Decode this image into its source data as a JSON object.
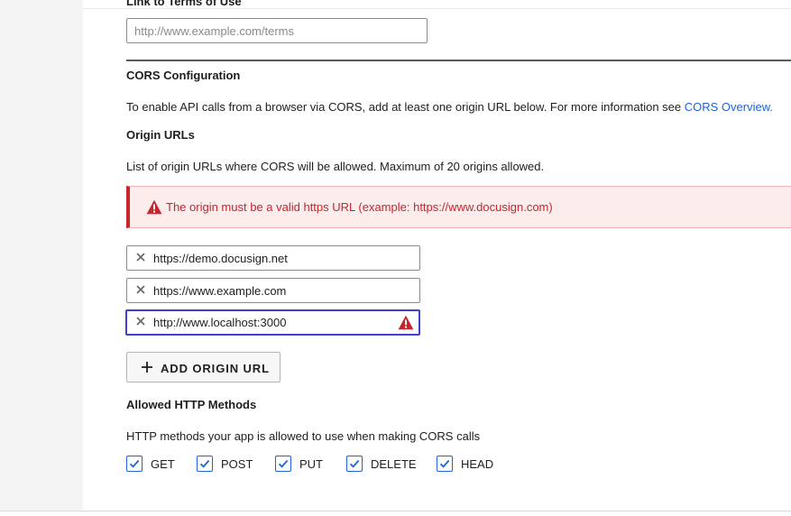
{
  "terms": {
    "label": "Link to Terms of Use",
    "placeholder": "http://www.example.com/terms"
  },
  "cors": {
    "heading": "CORS Configuration",
    "description": "To enable API calls from a browser via CORS, add at least one origin URL below. For more information see ",
    "link": "CORS Overview."
  },
  "origins": {
    "heading": "Origin URLs",
    "description": "List of origin URLs where CORS will be allowed. Maximum of 20 origins allowed.",
    "error_message": "The origin must be a valid https URL (example: https://www.docusign.com)",
    "items": [
      {
        "value": "https://demo.docusign.net"
      },
      {
        "value": "https://www.example.com"
      },
      {
        "value": "http://www.localhost:3000",
        "invalid": true
      }
    ],
    "add_button": "ADD ORIGIN URL"
  },
  "methods": {
    "heading": "Allowed HTTP Methods",
    "description": "HTTP methods your app is allowed to use when making CORS calls",
    "items": [
      {
        "label": "GET",
        "checked": true
      },
      {
        "label": "POST",
        "checked": true
      },
      {
        "label": "PUT",
        "checked": true
      },
      {
        "label": "DELETE",
        "checked": true
      },
      {
        "label": "HEAD",
        "checked": true
      }
    ]
  },
  "colors": {
    "accent": "#1f63d6",
    "error": "#c4262e",
    "error_bg": "#fcecec",
    "focus_border": "#3f3fd0"
  }
}
